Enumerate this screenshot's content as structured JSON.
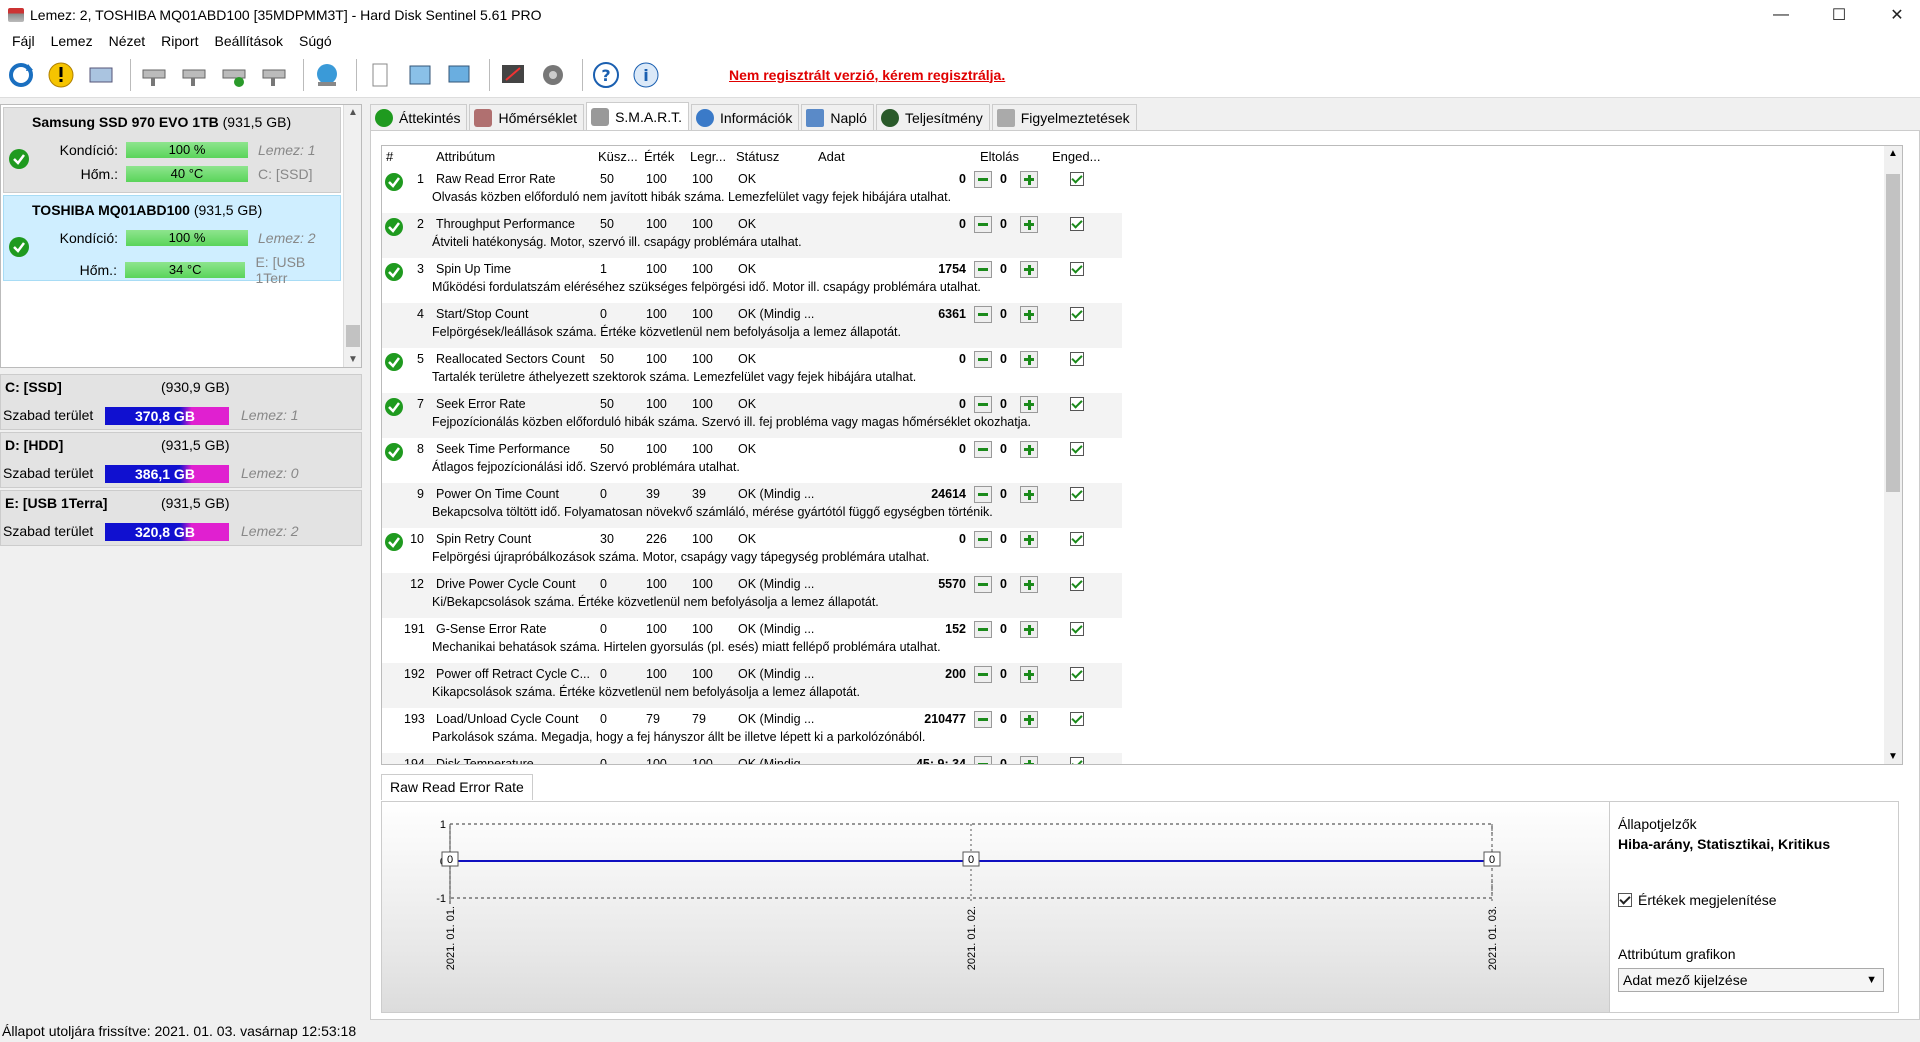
{
  "window": {
    "title": "Lemez: 2, TOSHIBA MQ01ABD100 [35MDPMM3T]  -  Hard Disk Sentinel 5.61 PRO",
    "minimize": "—",
    "maximize": "☐",
    "close": "✕"
  },
  "menu": [
    "Fájl",
    "Lemez",
    "Nézet",
    "Riport",
    "Beállítások",
    "Súgó"
  ],
  "toolbar": {
    "warning_link": "Nem regisztrált verzió, kérem regisztrálja."
  },
  "disks": [
    {
      "name": "Samsung SSD 970 EVO 1TB",
      "size": "(931,5 GB)",
      "health_label": "Kondíció:",
      "health": "100 %",
      "health_pct": 100,
      "temp_label": "Hőm.:",
      "temp": "40 °C",
      "extra1": "Lemez: 1",
      "extra2": "C: [SSD]"
    },
    {
      "name": "TOSHIBA MQ01ABD100",
      "size": "(931,5 GB)",
      "health_label": "Kondíció:",
      "health": "100 %",
      "health_pct": 100,
      "temp_label": "Hőm.:",
      "temp": "34 °C",
      "extra1": "Lemez: 2",
      "extra2": "E: [USB 1Terr"
    }
  ],
  "volumes": [
    {
      "name": "C: [SSD]",
      "size": "(930,9 GB)",
      "free_label": "Szabad terület",
      "free": "370,8 GB",
      "disk": "Lemez: 1"
    },
    {
      "name": "D: [HDD]",
      "size": "(931,5 GB)",
      "free_label": "Szabad terület",
      "free": "386,1 GB",
      "disk": "Lemez: 0"
    },
    {
      "name": "E: [USB 1Terra]",
      "size": "(931,5 GB)",
      "free_label": "Szabad terület",
      "free": "320,8 GB",
      "disk": "Lemez: 2"
    }
  ],
  "tabs": [
    "Áttekintés",
    "Hőmérséklet",
    "S.M.A.R.T.",
    "Információk",
    "Napló",
    "Teljesítmény",
    "Figyelmeztetések"
  ],
  "smart": {
    "headers": {
      "id": "#",
      "attr": "Attribútum",
      "thr": "Küsz...",
      "val": "Érték",
      "worst": "Legr...",
      "status": "Státusz",
      "data": "Adat",
      "offset": "Eltolás",
      "enabled": "Enged..."
    },
    "rows": [
      {
        "ok": true,
        "id": "1",
        "name": "Raw Read Error Rate",
        "thr": "50",
        "val": "100",
        "worst": "100",
        "status": "OK",
        "data": "0",
        "off": "0",
        "desc": "Olvasás közben előforduló nem javított hibák száma. Lemezfelület vagy fejek hibájára utalhat."
      },
      {
        "ok": true,
        "id": "2",
        "name": "Throughput Performance",
        "thr": "50",
        "val": "100",
        "worst": "100",
        "status": "OK",
        "data": "0",
        "off": "0",
        "desc": "Átviteli hatékonyság. Motor, szervó ill. csapágy problémára utalhat."
      },
      {
        "ok": true,
        "id": "3",
        "name": "Spin Up Time",
        "thr": "1",
        "val": "100",
        "worst": "100",
        "status": "OK",
        "data": "1754",
        "off": "0",
        "desc": "Működési fordulatszám eléréséhez szükséges felpörgési idő. Motor ill. csapágy problémára utalhat."
      },
      {
        "ok": false,
        "id": "4",
        "name": "Start/Stop Count",
        "thr": "0",
        "val": "100",
        "worst": "100",
        "status": "OK (Mindig ...",
        "data": "6361",
        "off": "0",
        "desc": "Felpörgések/leállások száma. Értéke közvetlenül nem befolyásolja a lemez állapotát."
      },
      {
        "ok": true,
        "id": "5",
        "name": "Reallocated Sectors Count",
        "thr": "50",
        "val": "100",
        "worst": "100",
        "status": "OK",
        "data": "0",
        "off": "0",
        "desc": "Tartalék területre áthelyezett szektorok száma. Lemezfelület vagy fejek hibájára utalhat."
      },
      {
        "ok": true,
        "id": "7",
        "name": "Seek Error Rate",
        "thr": "50",
        "val": "100",
        "worst": "100",
        "status": "OK",
        "data": "0",
        "off": "0",
        "desc": "Fejpozícionálás közben előforduló hibák száma. Szervó ill. fej probléma vagy magas hőmérséklet okozhatja."
      },
      {
        "ok": true,
        "id": "8",
        "name": "Seek Time Performance",
        "thr": "50",
        "val": "100",
        "worst": "100",
        "status": "OK",
        "data": "0",
        "off": "0",
        "desc": "Átlagos fejpozícionálási idő. Szervó problémára utalhat."
      },
      {
        "ok": false,
        "id": "9",
        "name": "Power On Time Count",
        "thr": "0",
        "val": "39",
        "worst": "39",
        "status": "OK (Mindig ...",
        "data": "24614",
        "off": "0",
        "desc": "Bekapcsolva töltött idő. Folyamatosan növekvő számláló, mérése gyártótól függő egységben történik."
      },
      {
        "ok": true,
        "id": "10",
        "name": "Spin Retry Count",
        "thr": "30",
        "val": "226",
        "worst": "100",
        "status": "OK",
        "data": "0",
        "off": "0",
        "desc": "Felpörgési újrapróbálkozások száma. Motor, csapágy vagy tápegység problémára utalhat."
      },
      {
        "ok": false,
        "id": "12",
        "name": "Drive Power Cycle Count",
        "thr": "0",
        "val": "100",
        "worst": "100",
        "status": "OK (Mindig ...",
        "data": "5570",
        "off": "0",
        "desc": "Ki/Bekapcsolások száma. Értéke közvetlenül nem befolyásolja a lemez állapotát."
      },
      {
        "ok": false,
        "id": "191",
        "name": "G-Sense Error Rate",
        "thr": "0",
        "val": "100",
        "worst": "100",
        "status": "OK (Mindig ...",
        "data": "152",
        "off": "0",
        "desc": "Mechanikai behatások száma. Hirtelen gyorsulás (pl. esés) miatt fellépő problémára utalhat."
      },
      {
        "ok": false,
        "id": "192",
        "name": "Power off Retract Cycle C...",
        "thr": "0",
        "val": "100",
        "worst": "100",
        "status": "OK (Mindig ...",
        "data": "200",
        "off": "0",
        "desc": "Kikapcsolások száma. Értéke közvetlenül nem befolyásolja a lemez állapotát."
      },
      {
        "ok": false,
        "id": "193",
        "name": "Load/Unload Cycle Count",
        "thr": "0",
        "val": "79",
        "worst": "79",
        "status": "OK (Mindig ...",
        "data": "210477",
        "off": "0",
        "desc": "Parkolások száma. Megadja, hogy a fej hányszor állt be illetve lépett ki a parkolózónából."
      },
      {
        "ok": false,
        "id": "194",
        "name": "Disk Temperature",
        "thr": "0",
        "val": "100",
        "worst": "100",
        "status": "OK (Mindig ...",
        "data": "45; 9; 34",
        "off": "0",
        "desc": ""
      }
    ]
  },
  "graph": {
    "tab_label": "Raw Read Error Rate",
    "chart_data": {
      "type": "line",
      "x": [
        "2021. 01. 01.",
        "2021. 01. 02.",
        "2021. 01. 03."
      ],
      "series": [
        {
          "values": [
            0,
            0,
            0
          ]
        }
      ],
      "ylim": [
        -1,
        1
      ],
      "yticks": [
        "1",
        "0",
        "-1"
      ],
      "point_labels": [
        "0",
        "0",
        "0"
      ],
      "color": "#1010c0"
    }
  },
  "side": {
    "title": "Állapotjelzők",
    "subtitle": "Hiba-arány, Statisztikai, Kritikus",
    "show_values": "Értékek megjelenítése",
    "graph_label": "Attribútum grafikon",
    "graph_select": "Adat mező kijelzése"
  },
  "status": "Állapot utoljára frissítve: 2021. 01. 03. vasárnap 12:53:18"
}
